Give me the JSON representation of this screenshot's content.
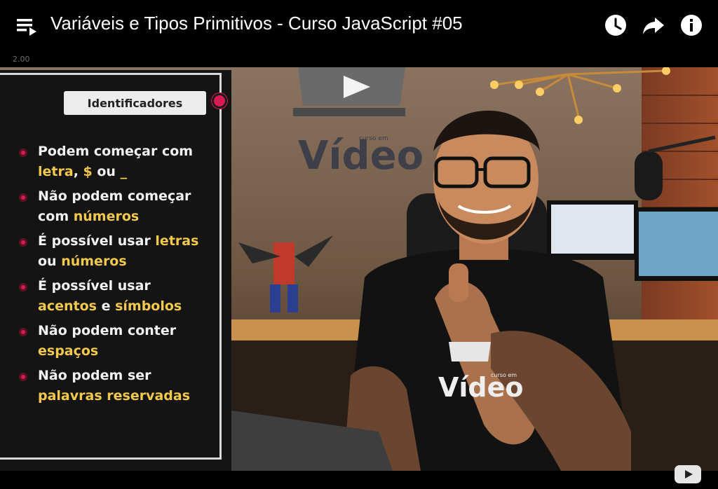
{
  "header": {
    "title": "Variáveis e Tipos Primitivos - Curso JavaScript #05",
    "playlist_icon": "playlist-icon",
    "watch_later_icon": "clock-icon",
    "share_icon": "share-arrow-icon",
    "info_icon": "info-icon",
    "speed": "2.00"
  },
  "slide": {
    "heading": "Identificadores",
    "bullets": [
      {
        "line1": [
          "Podem começar com"
        ],
        "line2": [
          {
            "t": "letra",
            "hl": true
          },
          {
            "t": ", ",
            "hl": false
          },
          {
            "t": "$",
            "hl": true
          },
          {
            "t": " ou ",
            "hl": false
          },
          {
            "t": "_",
            "hl": true
          }
        ]
      },
      {
        "line1": [
          "Não podem começar"
        ],
        "line2": [
          {
            "t": "com ",
            "hl": false
          },
          {
            "t": "números",
            "hl": true
          }
        ]
      },
      {
        "line1": [
          {
            "t": "É possível usar ",
            "hl": false
          },
          {
            "t": "letras",
            "hl": true
          }
        ],
        "line2": [
          {
            "t": "ou ",
            "hl": false
          },
          {
            "t": "números",
            "hl": true
          }
        ]
      },
      {
        "line1": [
          "É possível usar"
        ],
        "line2": [
          {
            "t": "acentos",
            "hl": true
          },
          {
            "t": " e ",
            "hl": false
          },
          {
            "t": "símbolos",
            "hl": true
          }
        ]
      },
      {
        "line1": [
          "Não podem conter"
        ],
        "line2": [
          {
            "t": "espaços",
            "hl": true
          }
        ]
      },
      {
        "line1": [
          "Não podem ser"
        ],
        "line2": [
          {
            "t": "palavras reservadas",
            "hl": true
          }
        ]
      }
    ]
  },
  "scene": {
    "wall_logo": "Vídeo",
    "wall_logo_small": "curso em",
    "shirt_logo": "Vídeo",
    "shirt_logo_small": "curso em"
  },
  "colors": {
    "accent": "#d81b50",
    "highlight": "#f2c94c",
    "slide_bg": "#141414"
  },
  "footer": {
    "logo_icon": "youtube-logo-icon"
  }
}
